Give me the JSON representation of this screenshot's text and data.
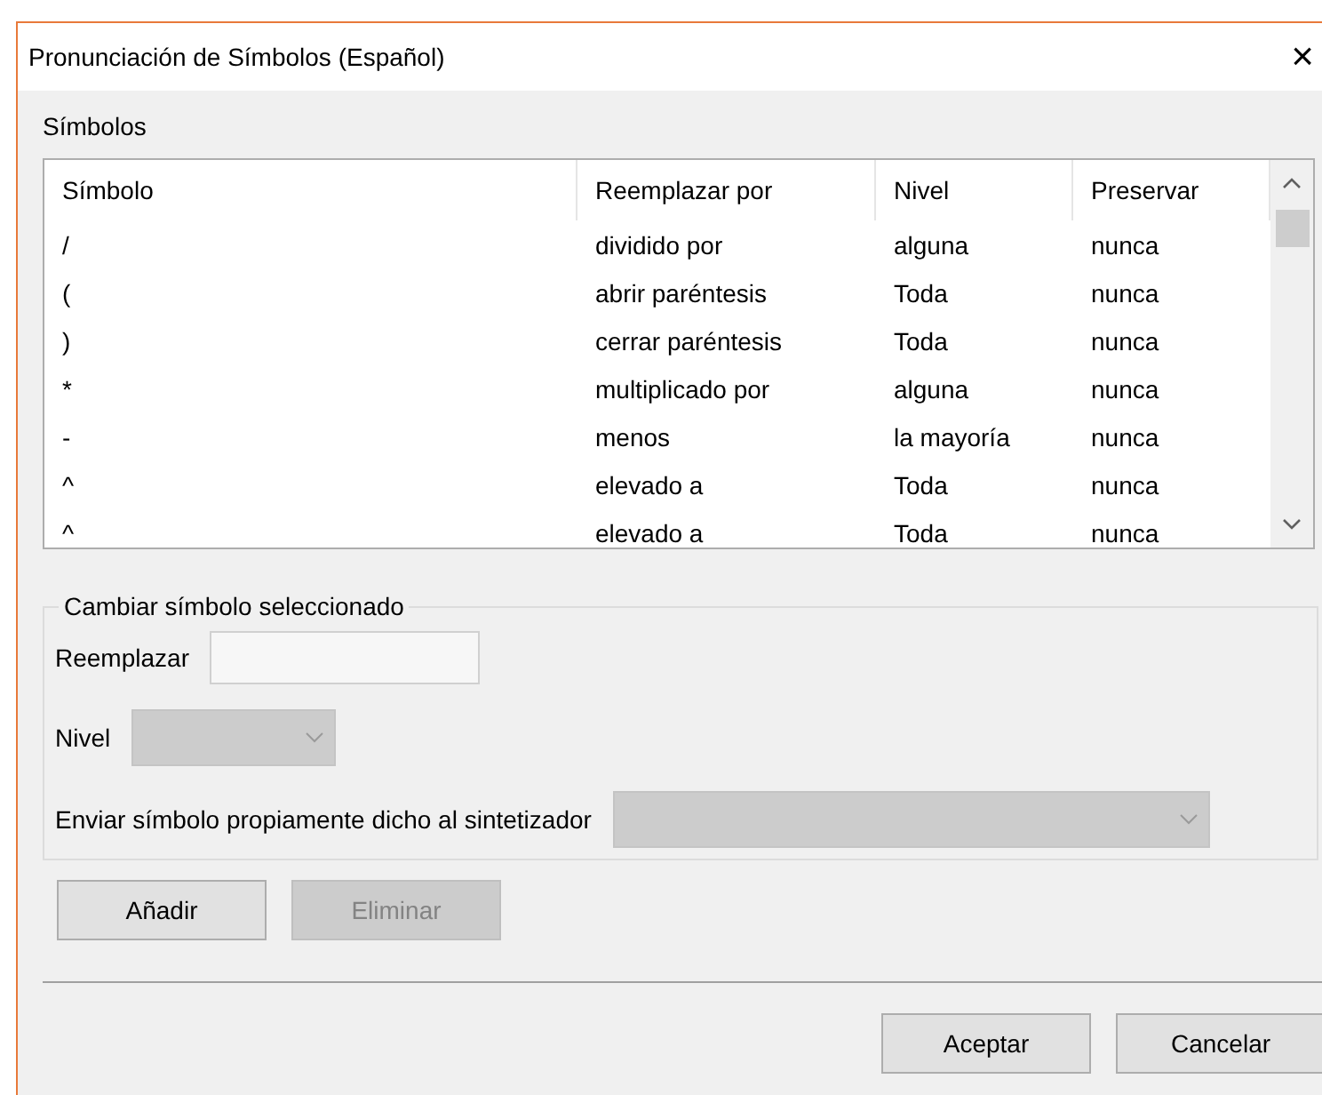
{
  "window": {
    "title": "Pronunciación de Símbolos (Español)",
    "close": "×"
  },
  "symbols": {
    "label": "Símbolos",
    "columns": [
      "Símbolo",
      "Reemplazar por",
      "Nivel",
      "Preservar"
    ],
    "rows": [
      {
        "symbol": "/",
        "replacement": "dividido por",
        "level": "alguna",
        "preserve": "nunca"
      },
      {
        "symbol": "(",
        "replacement": "abrir paréntesis",
        "level": "Toda",
        "preserve": "nunca"
      },
      {
        "symbol": ")",
        "replacement": "cerrar paréntesis",
        "level": "Toda",
        "preserve": "nunca"
      },
      {
        "symbol": "*",
        "replacement": "multiplicado por",
        "level": "alguna",
        "preserve": "nunca"
      },
      {
        "symbol": "-",
        "replacement": "menos",
        "level": "la mayoría",
        "preserve": "nunca"
      },
      {
        "symbol": "^",
        "replacement": "elevado a",
        "level": "Toda",
        "preserve": "nunca"
      },
      {
        "symbol": "^",
        "replacement": "elevado a",
        "level": "Toda",
        "preserve": "nunca"
      }
    ]
  },
  "edit_group": {
    "legend": "Cambiar símbolo seleccionado",
    "replace": {
      "label": "Reemplazar",
      "disabled": true
    },
    "level": {
      "label": "Nivel",
      "disabled": true
    },
    "send": {
      "label": "Enviar símbolo propiamente dicho al sintetizador",
      "disabled": true
    }
  },
  "list_buttons": [
    {
      "label": "Añadir",
      "disabled": false
    },
    {
      "label": "Eliminar",
      "disabled": true
    }
  ],
  "dialog_buttons": [
    {
      "label": "Aceptar",
      "disabled": false
    },
    {
      "label": "Cancelar",
      "disabled": false
    }
  ]
}
